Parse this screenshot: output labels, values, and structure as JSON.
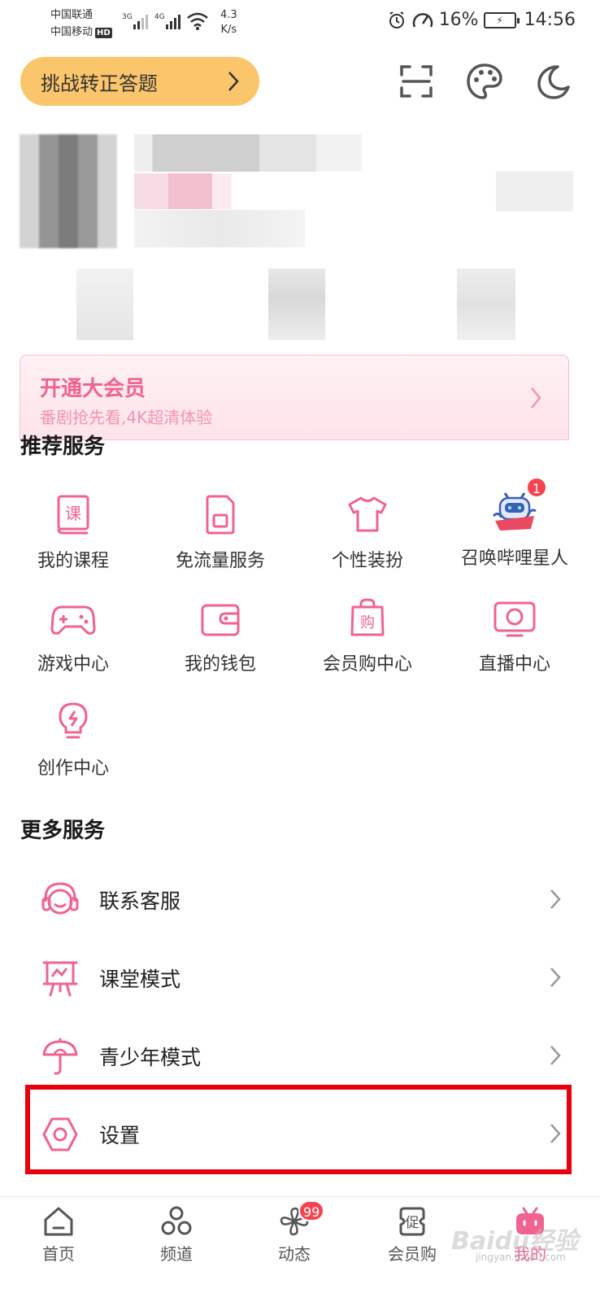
{
  "status_bar": {
    "carrier1": "中国联通",
    "carrier2": "中国移动",
    "hd": "HD",
    "net_speed_value": "4.3",
    "net_speed_unit": "K/s",
    "sig1_type": "3G",
    "sig2_type": "4G",
    "battery": "16%",
    "time": "14:56"
  },
  "header": {
    "challenge_label": "挑战转正答题"
  },
  "vip_banner": {
    "title": "开通大会员",
    "subtitle": "番剧抢先看,4K超清体验"
  },
  "recommended": {
    "title": "推荐服务",
    "items": [
      {
        "label": "我的课程",
        "icon": "course-book-icon"
      },
      {
        "label": "免流量服务",
        "icon": "sim-card-icon"
      },
      {
        "label": "个性装扮",
        "icon": "tshirt-icon"
      },
      {
        "label": "召唤哔哩星人",
        "icon": "bili-mascot-icon",
        "badge": "1"
      },
      {
        "label": "游戏中心",
        "icon": "gamepad-icon"
      },
      {
        "label": "我的钱包",
        "icon": "wallet-icon"
      },
      {
        "label": "会员购中心",
        "icon": "shopping-bag-icon"
      },
      {
        "label": "直播中心",
        "icon": "live-tv-icon"
      },
      {
        "label": "创作中心",
        "icon": "lightbulb-icon"
      }
    ]
  },
  "more": {
    "title": "更多服务",
    "items": [
      {
        "label": "联系客服",
        "icon": "headset-icon"
      },
      {
        "label": "课堂模式",
        "icon": "classroom-board-icon"
      },
      {
        "label": "青少年模式",
        "icon": "umbrella-icon"
      },
      {
        "label": "设置",
        "icon": "hex-settings-icon"
      }
    ]
  },
  "bottom_nav": {
    "tabs": [
      {
        "label": "首页",
        "icon": "home-icon"
      },
      {
        "label": "频道",
        "icon": "channel-icon"
      },
      {
        "label": "动态",
        "icon": "pinwheel-icon",
        "badge": "99"
      },
      {
        "label": "会员购",
        "icon": "promo-icon"
      },
      {
        "label": "我的",
        "icon": "tv-mascot-icon",
        "active": true
      }
    ]
  },
  "watermark": {
    "brand": "Baidu经验",
    "url": "jingyan.baidu.com"
  },
  "colors": {
    "accent": "#f06390",
    "challenge_bg": "#fbc56b",
    "badge": "#f5444f",
    "highlight_box": "#e8000b"
  }
}
